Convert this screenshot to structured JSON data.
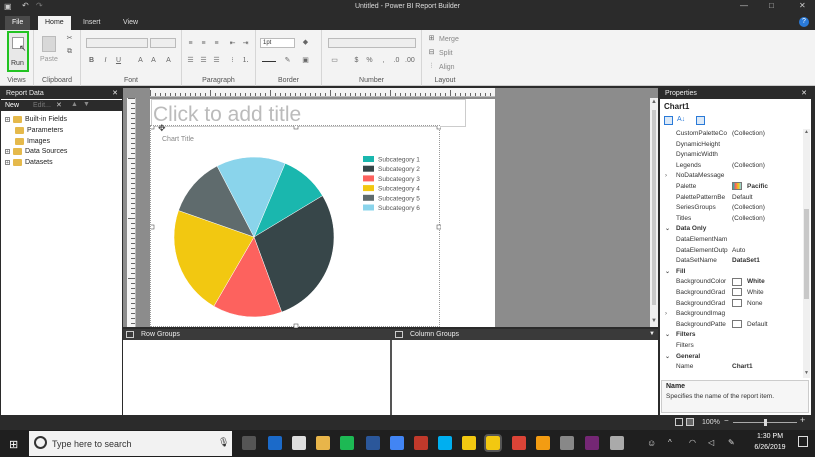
{
  "window": {
    "title": "Untitled - Power BI Report Builder"
  },
  "tabs": [
    "File",
    "Home",
    "Insert",
    "View"
  ],
  "ribbon": {
    "groups": {
      "views": "Views",
      "clipboard": "Clipboard",
      "font": "Font",
      "paragraph": "Paragraph",
      "border": "Border",
      "number": "Number",
      "layout": "Layout"
    },
    "run_label": "Run",
    "paste_label": "Paste",
    "border_width": "1pt",
    "merge_label": "Merge",
    "split_label": "Split",
    "align_label": "Align"
  },
  "report_data": {
    "title": "Report Data",
    "new_label": "New",
    "edit_label": "Edit...",
    "items": [
      "Built-in Fields",
      "Parameters",
      "Images",
      "Data Sources",
      "Datasets"
    ]
  },
  "report": {
    "title_placeholder": "Click to add title",
    "chart_title": "Chart Title"
  },
  "chart_data": {
    "type": "pie",
    "categories": [
      "Subcategory 1",
      "Subcategory 2",
      "Subcategory 3",
      "Subcategory 4",
      "Subcategory 5",
      "Subcategory 6"
    ],
    "values": [
      10,
      28,
      14,
      22,
      12,
      14
    ],
    "colors": [
      "#1ab7ae",
      "#374649",
      "#fd625e",
      "#f2c811",
      "#5f6b6d",
      "#8ad4eb"
    ],
    "legend_position": "right"
  },
  "groups": {
    "row": "Row Groups",
    "column": "Column Groups"
  },
  "properties": {
    "title": "Properties",
    "object": "Chart1",
    "rows": [
      {
        "k": "CustomPaletteCo",
        "v": "(Collection)"
      },
      {
        "k": "DynamicHeight",
        "v": ""
      },
      {
        "k": "DynamicWidth",
        "v": ""
      },
      {
        "k": "Legends",
        "v": "(Collection)"
      },
      {
        "k": "NoDataMessage",
        "v": "",
        "exp": true
      },
      {
        "k": "Palette",
        "v": "Pacific",
        "bold": true,
        "palette": true
      },
      {
        "k": "PalettePatternBe",
        "v": "Default"
      },
      {
        "k": "SeriesGroups",
        "v": "(Collection)"
      },
      {
        "k": "Titles",
        "v": "(Collection)"
      },
      {
        "k": "Data Only",
        "cat": true
      },
      {
        "k": "DataElementNam",
        "v": ""
      },
      {
        "k": "DataElementOutp",
        "v": "Auto"
      },
      {
        "k": "DataSetName",
        "v": "DataSet1",
        "bold": true
      },
      {
        "k": "Fill",
        "cat": true
      },
      {
        "k": "BackgroundColor",
        "v": "White",
        "bold": true,
        "swatch": true
      },
      {
        "k": "BackgroundGrad",
        "v": "White",
        "swatch": true
      },
      {
        "k": "BackgroundGrad",
        "v": "None",
        "swatch": true
      },
      {
        "k": "BackgroundImag",
        "v": "",
        "exp": true
      },
      {
        "k": "BackgroundPatte",
        "v": "Default",
        "swatch": true
      },
      {
        "k": "Filters",
        "cat": true
      },
      {
        "k": "Filters",
        "v": ""
      },
      {
        "k": "General",
        "cat": true
      },
      {
        "k": "Name",
        "v": "Chart1",
        "bold": true
      }
    ],
    "help_title": "Name",
    "help_text": "Specifies the name of the report item."
  },
  "status": {
    "zoom": "100%"
  },
  "taskbar": {
    "search_placeholder": "Type here to search",
    "time": "1:30 PM",
    "date": "6/26/2019"
  }
}
